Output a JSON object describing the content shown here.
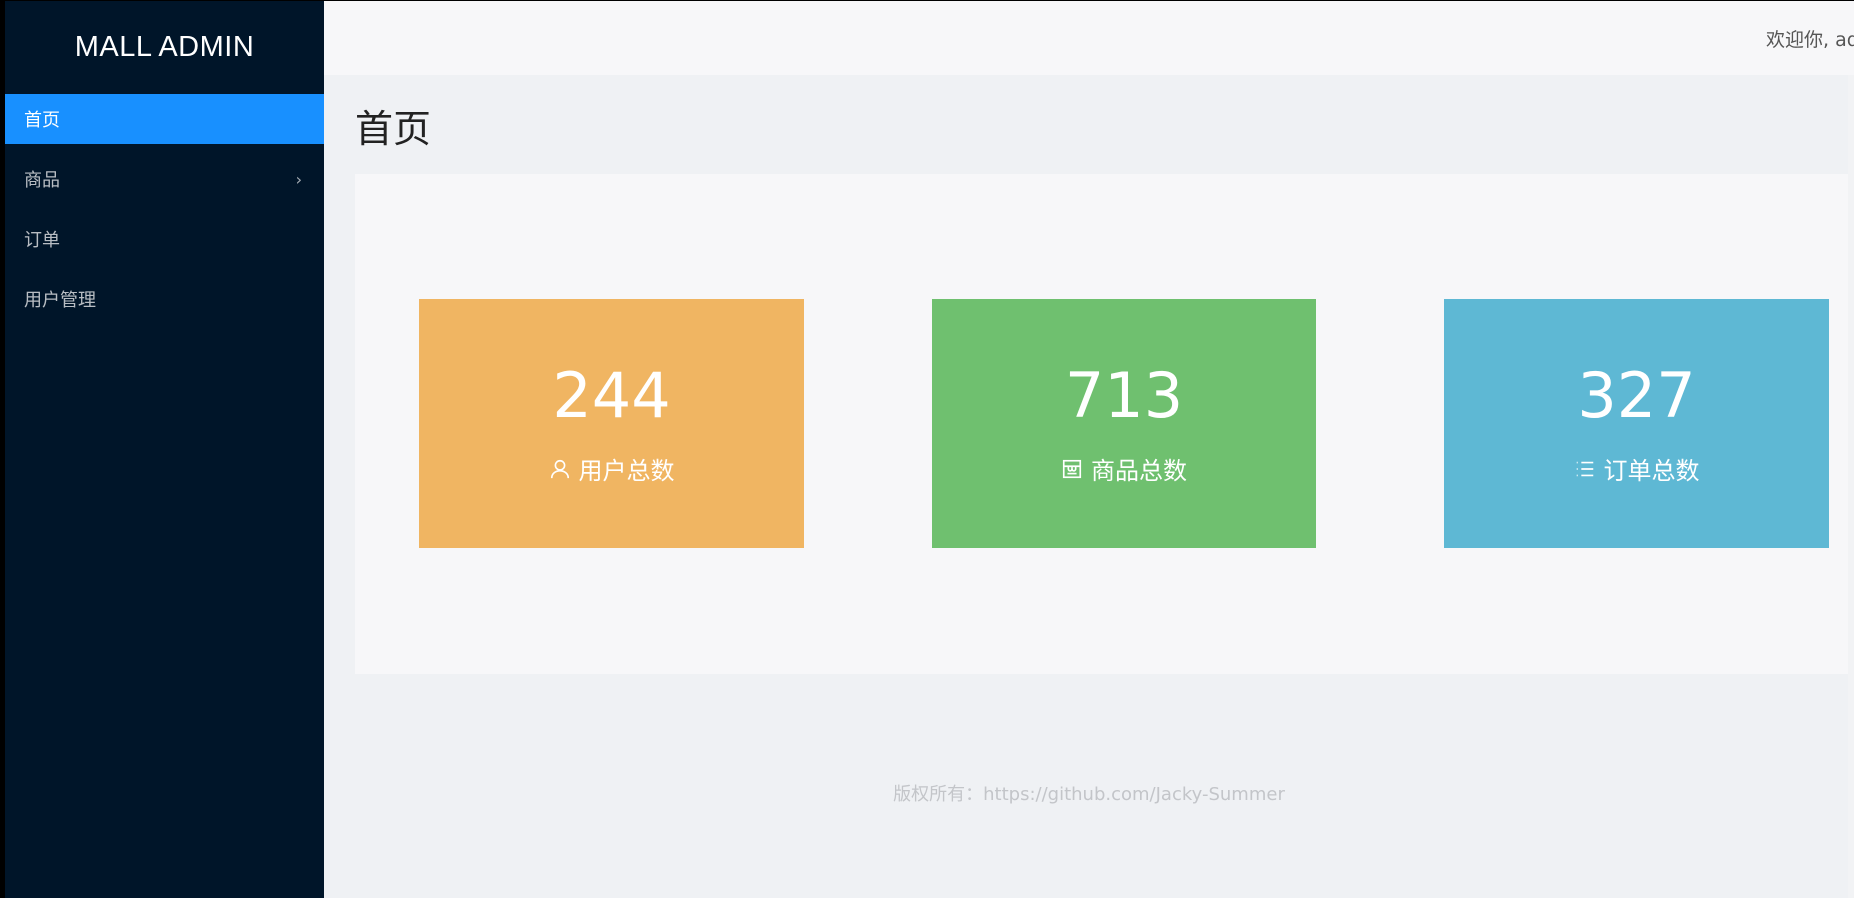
{
  "sidebar": {
    "logo": "MALL ADMIN",
    "items": [
      {
        "label": "首页",
        "active": true
      },
      {
        "label": "商品",
        "active": false,
        "has_submenu": true
      },
      {
        "label": "订单",
        "active": false
      },
      {
        "label": "用户管理",
        "active": false
      }
    ],
    "arrow_glyph": "›"
  },
  "header": {
    "welcome": "欢迎你, ad"
  },
  "page": {
    "title": "首页"
  },
  "stats": [
    {
      "value": "244",
      "label": "用户总数",
      "icon": "user-icon",
      "color": "#f0b562"
    },
    {
      "value": "713",
      "label": "商品总数",
      "icon": "shop-icon",
      "color": "#6fc06f"
    },
    {
      "value": "327",
      "label": "订单总数",
      "icon": "list-icon",
      "color": "#5eb8d4"
    }
  ],
  "footer": {
    "copyright": "版权所有：https://github.com/Jacky-Summer"
  },
  "colors": {
    "sidebar_bg": "#001529",
    "active": "#1890ff"
  }
}
